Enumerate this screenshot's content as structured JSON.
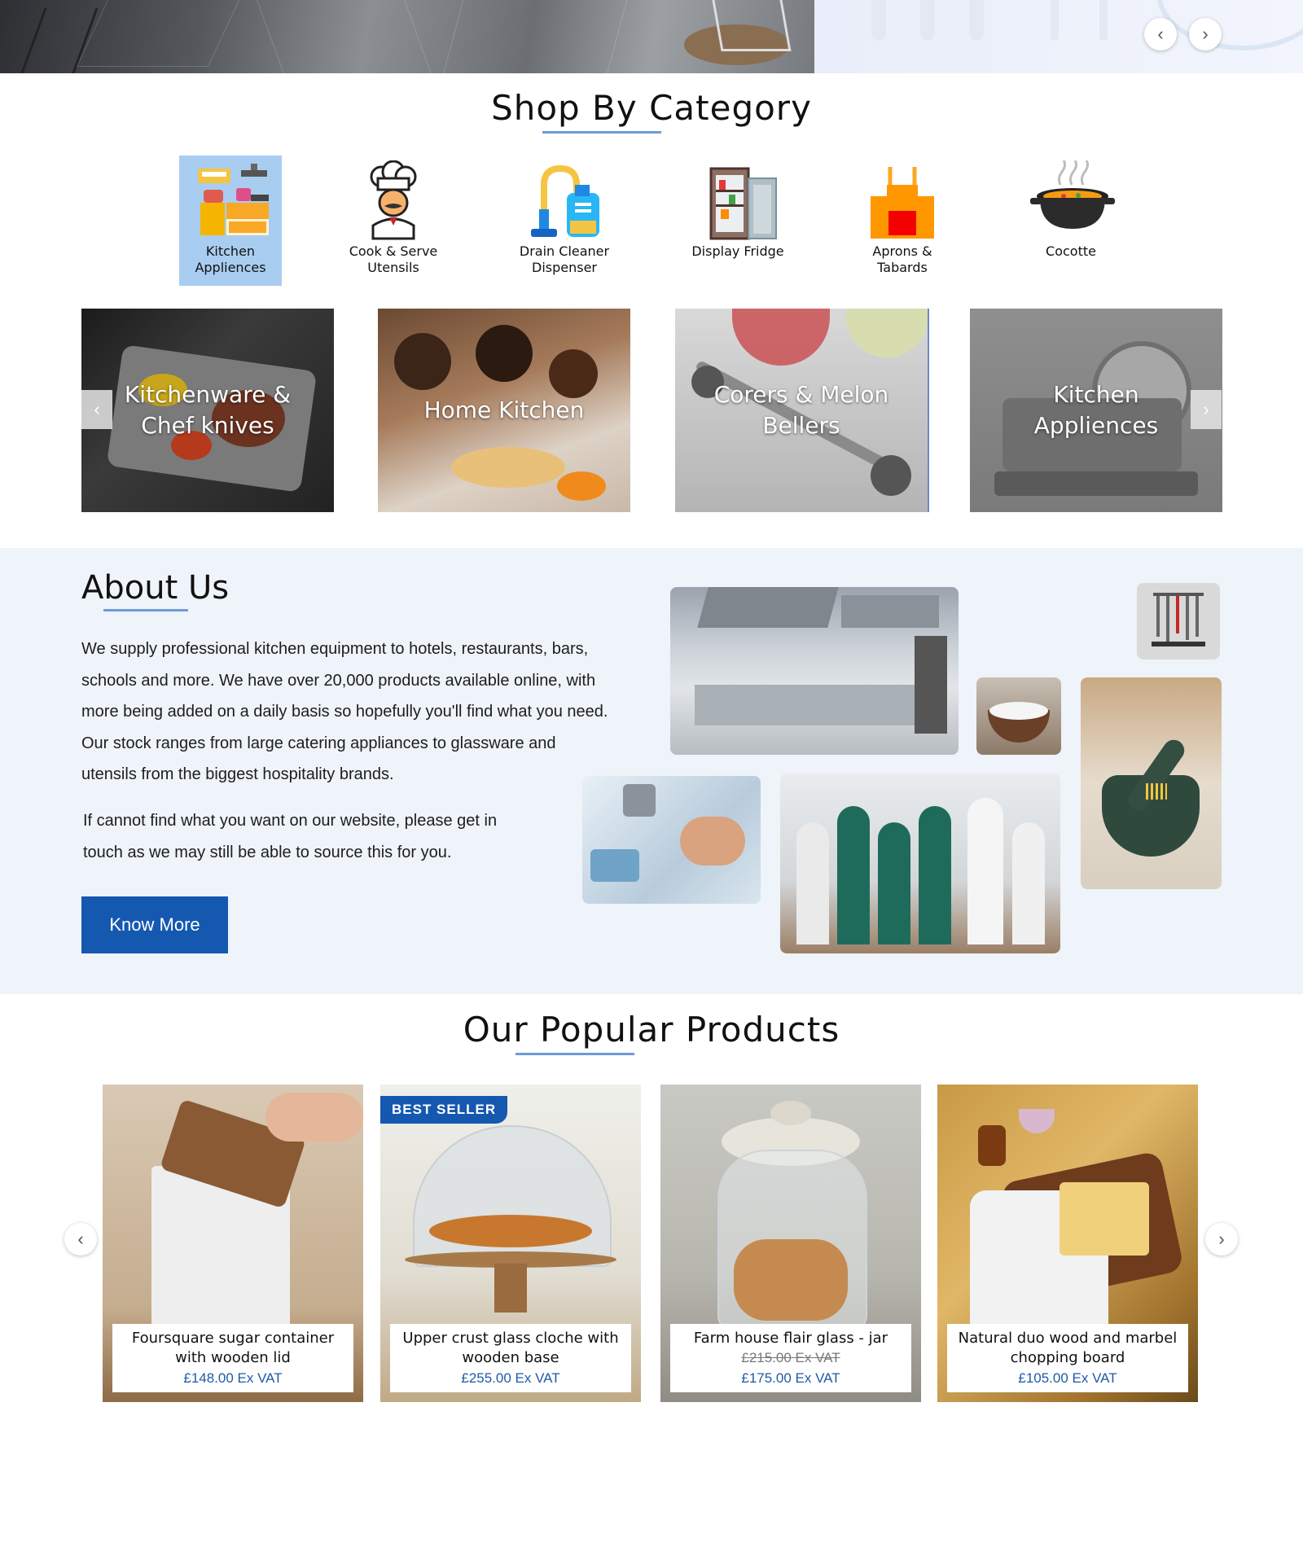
{
  "hero": {
    "prev_icon": "chevron-left-icon",
    "next_icon": "chevron-right-icon"
  },
  "shop_by_category": {
    "title": "Shop By Category",
    "categories": [
      {
        "label_line1": "Kitchen",
        "label_line2": "Appliences",
        "icon": "kitchen-appliances-icon",
        "selected": true
      },
      {
        "label_line1": "Cook & Serve",
        "label_line2": "Utensils",
        "icon": "chef-icon"
      },
      {
        "label_line1": "Drain Cleaner",
        "label_line2": "Dispenser",
        "icon": "drain-cleaner-icon"
      },
      {
        "label_line1": "Display Fridge",
        "label_line2": "",
        "icon": "fridge-icon"
      },
      {
        "label_line1": "Aprons &",
        "label_line2": "Tabards",
        "icon": "apron-icon"
      },
      {
        "label_line1": "Cocotte",
        "label_line2": "",
        "icon": "cocotte-pot-icon"
      }
    ],
    "selected_color": "#a9cdf0"
  },
  "banners": [
    {
      "line1": "Kitchenware &",
      "line2": "Chef knives"
    },
    {
      "line1": "Home Kitchen",
      "line2": ""
    },
    {
      "line1": "Corers & Melon",
      "line2": "Bellers"
    },
    {
      "line1": "Kitchen",
      "line2": "Appliences"
    }
  ],
  "about": {
    "title": "About Us",
    "paragraph1": "We supply professional kitchen equipment to hotels, restaurants, bars, schools and more. We have over 20,000 products available online, with more being added on a daily basis so hopefully you'll find what you need. Our stock ranges from large catering appliances  to glassware and utensils from the biggest hospitality brands.",
    "paragraph2": "If cannot find what you want on our website, please get in touch as we may still be able to source this for you.",
    "button": "Know More"
  },
  "popular": {
    "title": "Our Popular Products",
    "products": [
      {
        "name": "Foursquare sugar container with wooden lid",
        "old_price": "",
        "price": "£148.00 Ex VAT",
        "badge": ""
      },
      {
        "name": "Upper crust glass cloche with wooden base",
        "old_price": "",
        "price": "£255.00 Ex VAT",
        "badge": "BEST SELLER"
      },
      {
        "name": "Farm house flair glass - jar",
        "old_price": "£215.00 Ex VAT",
        "price": "£175.00 Ex VAT",
        "badge": ""
      },
      {
        "name": "Natural duo wood and marbel chopping board",
        "old_price": "",
        "price": "£105.00 Ex VAT",
        "badge": ""
      }
    ]
  },
  "colors": {
    "accent": "#1558b0",
    "underline": "#6c9bd8",
    "about_bg": "#eff3fa",
    "price": "#1f5aa6"
  }
}
